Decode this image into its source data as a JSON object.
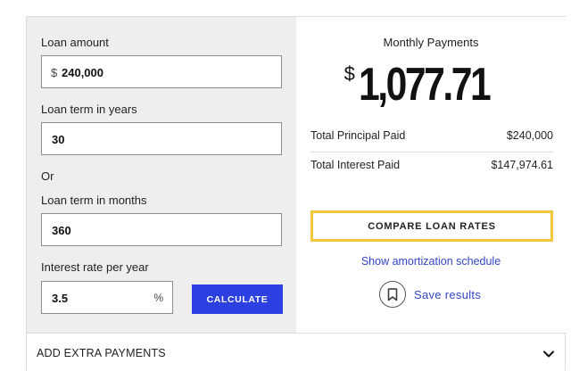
{
  "inputs": {
    "loan_amount_label": "Loan amount",
    "currency_symbol": "$",
    "loan_amount_value": "240,000",
    "term_years_label": "Loan term in years",
    "term_years_value": "30",
    "or_label": "Or",
    "term_months_label": "Loan term in months",
    "term_months_value": "360",
    "rate_label": "Interest rate per year",
    "rate_value": "3.5",
    "percent_symbol": "%",
    "calculate_label": "CALCULATE"
  },
  "results": {
    "monthly_label": "Monthly Payments",
    "monthly_currency": "$",
    "monthly_amount": "1,077.71",
    "principal_label": "Total Principal Paid",
    "principal_value": "$240,000",
    "interest_label": "Total Interest Paid",
    "interest_value": "$147,974.61",
    "compare_label": "COMPARE LOAN RATES",
    "amortization_label": "Show amortization schedule",
    "save_label": "Save results"
  },
  "extra": {
    "label": "ADD EXTRA PAYMENTS"
  },
  "colors": {
    "accent": "#2c3fe0",
    "link": "#3246c8",
    "highlight": "#f3c93b",
    "panel": "#eeeeef"
  },
  "icons": [
    "bookmark-icon",
    "chevron-down-icon"
  ]
}
